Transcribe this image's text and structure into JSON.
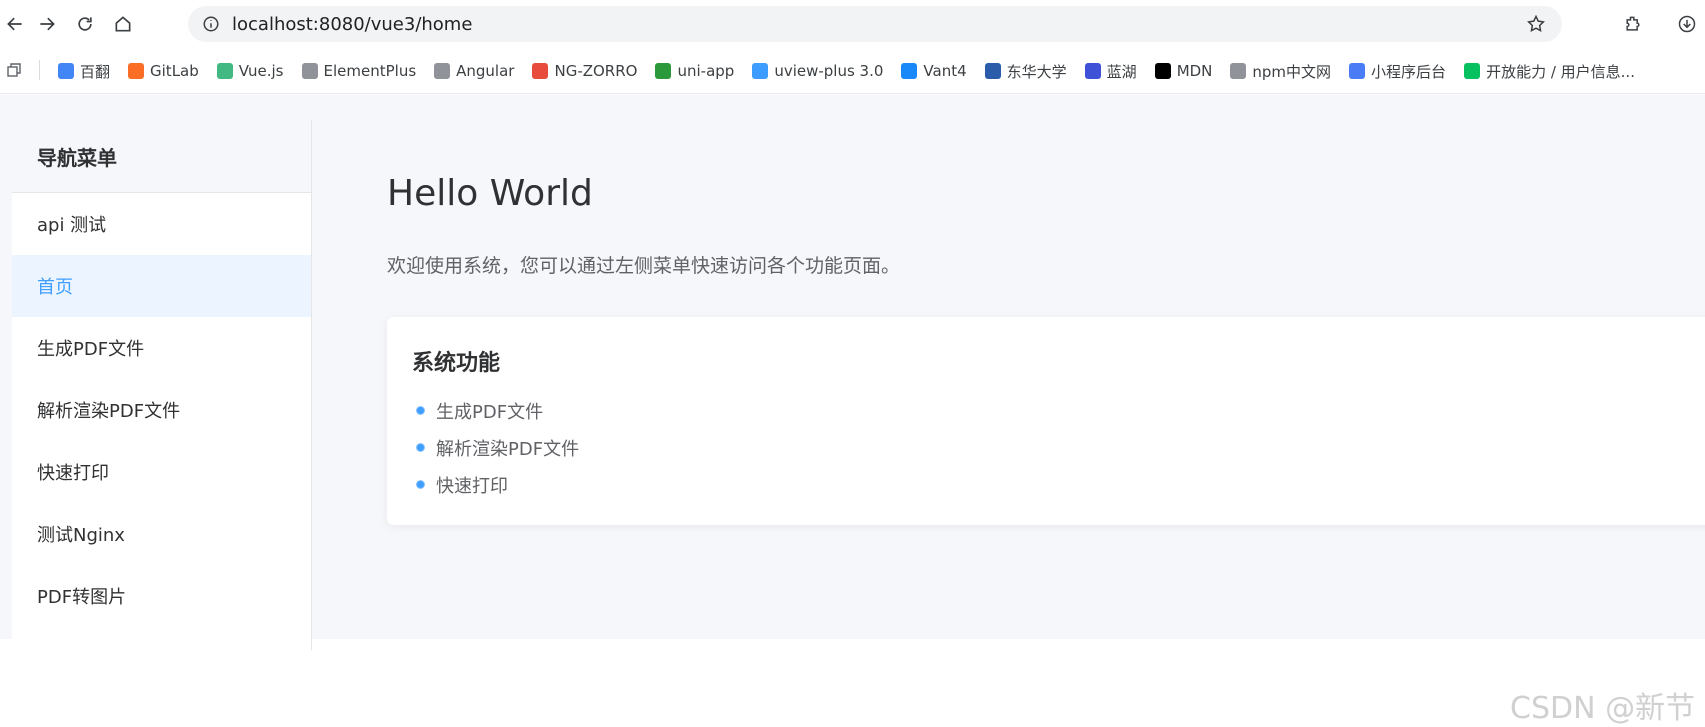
{
  "browser": {
    "url": "localhost:8080/vue3/home",
    "bookmarks": [
      {
        "label": "百翻",
        "color": "#4285f4",
        "icon": "translate-icon"
      },
      {
        "label": "GitLab",
        "color": "#fc6d26",
        "icon": "gitlab-icon"
      },
      {
        "label": "Vue.js",
        "color": "#42b883",
        "icon": "vue-icon"
      },
      {
        "label": "ElementPlus",
        "color": "#909399",
        "icon": "globe-icon"
      },
      {
        "label": "Angular",
        "color": "#909399",
        "icon": "globe-icon"
      },
      {
        "label": "NG-ZORRO",
        "color": "#e74c3c",
        "icon": "ng-zorro-icon"
      },
      {
        "label": "uni-app",
        "color": "#2b9939",
        "icon": "uniapp-icon"
      },
      {
        "label": "uview-plus 3.0",
        "color": "#3c9cff",
        "icon": "uview-icon"
      },
      {
        "label": "Vant4",
        "color": "#1989fa",
        "icon": "vant-icon"
      },
      {
        "label": "东华大学",
        "color": "#2a5caa",
        "icon": "university-icon"
      },
      {
        "label": "蓝湖",
        "color": "#3f51d7",
        "icon": "lanhu-icon"
      },
      {
        "label": "MDN",
        "color": "#000000",
        "icon": "mdn-icon"
      },
      {
        "label": "npm中文网",
        "color": "#909399",
        "icon": "globe-icon"
      },
      {
        "label": "小程序后台",
        "color": "#4a7cf6",
        "icon": "link-icon"
      },
      {
        "label": "开放能力 / 用户信息...",
        "color": "#07c160",
        "icon": "wechat-icon"
      }
    ]
  },
  "sidebar": {
    "title": "导航菜单",
    "items": [
      {
        "label": "api 测试",
        "active": false
      },
      {
        "label": "首页",
        "active": true
      },
      {
        "label": "生成PDF文件",
        "active": false
      },
      {
        "label": "解析渲染PDF文件",
        "active": false
      },
      {
        "label": "快速打印",
        "active": false
      },
      {
        "label": "测试Nginx",
        "active": false
      },
      {
        "label": "PDF转图片",
        "active": false
      }
    ]
  },
  "main": {
    "title": "Hello World",
    "subtitle": "欢迎使用系统，您可以通过左侧菜单快速访问各个功能页面。",
    "card": {
      "title": "系统功能",
      "features": [
        "生成PDF文件",
        "解析渲染PDF文件",
        "快速打印"
      ]
    }
  },
  "watermark": "CSDN @新节",
  "colors": {
    "accent": "#409eff",
    "active_bg": "#ecf5ff",
    "page_bg": "#f5f7fa"
  }
}
